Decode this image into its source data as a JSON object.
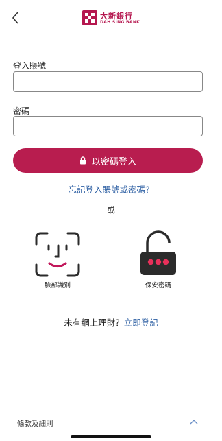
{
  "header": {
    "bank_name_cn": "大新銀行",
    "bank_name_en": "DAH SING BANK",
    "colors": {
      "brand": "#b5174f"
    }
  },
  "form": {
    "account_label": "登入賬號",
    "account_value": "",
    "password_label": "密碼",
    "password_value": ""
  },
  "login_button": {
    "label": "以密碼登入",
    "icon": "lock-icon",
    "color": "#b81d4f"
  },
  "forgot_link": "忘記登入賬號或密碼？",
  "or_text": "或",
  "biometric": {
    "face_id_label": "臉部識別",
    "face_id_icon": "face-id-icon",
    "secure_code_label": "保安密碼",
    "secure_code_icon": "padlock-code-icon"
  },
  "signup": {
    "prompt": "未有網上理財？",
    "link": "立即登記"
  },
  "footer": {
    "terms_label": "條款及細則",
    "toggle_icon": "chevron-up-icon"
  }
}
